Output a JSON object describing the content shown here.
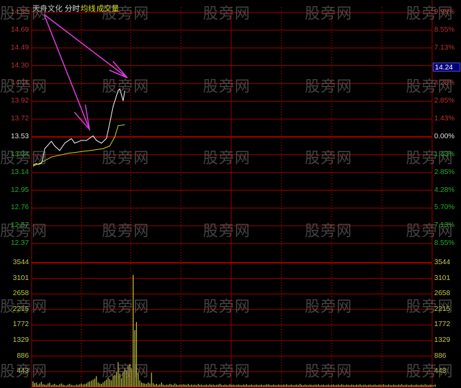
{
  "header": {
    "stock_name": "天舟文化",
    "mode": "分时",
    "avg_legend": "均线",
    "volume_legend": "成交量"
  },
  "watermark": "股旁网",
  "current_price_tag": "14.24",
  "colors": {
    "up": "#c03030",
    "down": "#20b020",
    "flat": "#e0e0e0",
    "price_line": "#ffffff",
    "avg_line": "#d8d820",
    "volume": "#c8c840",
    "grid": "#a00000",
    "arrow": "#e040e0",
    "tag_bg": "#00007a"
  },
  "chart_data": [
    {
      "type": "line",
      "title": "分时",
      "prev_close": 13.53,
      "ylim": [
        12.37,
        14.88
      ],
      "y_ticks_left": [
        "14.88",
        "14.69",
        "14.49",
        "14.30",
        "14.11",
        "13.92",
        "13.72",
        "13.53",
        "13.34",
        "13.14",
        "12.95",
        "12.76",
        "12.57",
        "12.37"
      ],
      "y_ticks_right": [
        "9.98%",
        "8.55%",
        "7.13%",
        "5.70%",
        "4.28%",
        "2.85%",
        "1.43%",
        "0.00%",
        "1.43%",
        "2.85%",
        "4.28%",
        "5.70%",
        "7.13%",
        "8.55%"
      ],
      "xlim_minutes": [
        0,
        240
      ],
      "series": [
        {
          "name": "价格",
          "points": [
            [
              0,
              13.22
            ],
            [
              2,
              13.24
            ],
            [
              3,
              13.23
            ],
            [
              5,
              13.24
            ],
            [
              6,
              13.3
            ],
            [
              7,
              13.4
            ],
            [
              9,
              13.44
            ],
            [
              11,
              13.48
            ],
            [
              13,
              13.43
            ],
            [
              16,
              13.38
            ],
            [
              19,
              13.46
            ],
            [
              23,
              13.51
            ],
            [
              25,
              13.46
            ],
            [
              29,
              13.49
            ],
            [
              32,
              13.49
            ],
            [
              36,
              13.54
            ],
            [
              38,
              13.49
            ],
            [
              41,
              13.46
            ],
            [
              44,
              13.51
            ],
            [
              46,
              13.68
            ],
            [
              48,
              13.86
            ],
            [
              51,
              14.03
            ],
            [
              52,
              14.05
            ],
            [
              54,
              13.92
            ],
            [
              55,
              14.03
            ]
          ]
        },
        {
          "name": "均线",
          "points": [
            [
              0,
              13.21
            ],
            [
              5,
              13.25
            ],
            [
              11,
              13.31
            ],
            [
              21,
              13.35
            ],
            [
              34,
              13.38
            ],
            [
              42,
              13.4
            ],
            [
              46,
              13.43
            ],
            [
              49,
              13.53
            ],
            [
              51,
              13.65
            ],
            [
              55,
              13.66
            ]
          ]
        }
      ]
    },
    {
      "type": "bar",
      "title": "成交量",
      "ylim": [
        0,
        3544
      ],
      "y_ticks": [
        "3544",
        "3101",
        "2658",
        "2215",
        "1772",
        "1329",
        "886",
        "443"
      ],
      "values": [
        150,
        100,
        120,
        60,
        90,
        140,
        70,
        60,
        50,
        90,
        110,
        40,
        60,
        80,
        50,
        40,
        70,
        90,
        60,
        40,
        30,
        60,
        80,
        50,
        40,
        30,
        60,
        50,
        70,
        90,
        60,
        80,
        90,
        130,
        150,
        170,
        200,
        230,
        300,
        120,
        90,
        80,
        120,
        160,
        200,
        260,
        210,
        180,
        300,
        330,
        420,
        700,
        380,
        240,
        420,
        520,
        470,
        600,
        650,
        520,
        3200,
        1620,
        1850,
        400,
        180,
        120,
        100,
        90,
        80,
        120,
        90,
        400,
        100,
        60,
        80,
        50,
        70,
        120,
        60,
        40,
        60,
        50,
        80,
        60,
        50,
        90,
        60,
        40,
        60,
        50,
        70,
        60,
        50,
        80,
        40,
        60,
        50,
        60,
        40,
        80,
        50,
        60,
        40,
        50,
        60,
        40,
        70,
        50,
        60,
        40,
        50,
        60,
        80,
        50,
        40,
        60,
        50,
        40,
        70,
        50,
        60,
        40,
        50,
        60,
        50,
        40,
        60,
        50,
        70,
        40,
        50,
        60,
        40,
        50,
        60,
        40,
        50,
        60,
        40,
        50,
        60,
        70,
        50,
        40,
        60,
        50,
        40,
        60,
        50,
        40,
        60,
        50,
        70,
        40,
        50,
        60,
        40,
        50,
        60,
        40,
        80,
        50,
        40,
        60,
        50,
        40,
        60,
        50,
        40,
        60,
        50,
        70,
        40,
        50,
        60,
        40,
        50,
        60,
        40,
        50,
        60,
        40,
        50,
        60,
        40,
        70,
        50,
        40,
        60,
        50,
        40,
        60,
        50,
        40,
        60,
        50,
        70,
        40,
        50,
        60,
        40,
        50,
        60,
        40,
        50,
        60,
        40,
        50,
        60,
        40,
        70,
        50,
        40,
        60,
        50,
        40,
        60,
        50,
        40,
        60,
        50,
        70,
        40,
        50,
        60,
        40,
        50,
        60,
        40,
        50,
        60,
        40,
        50,
        60,
        40,
        70,
        50,
        40,
        60,
        50,
        40,
        60
      ]
    }
  ]
}
